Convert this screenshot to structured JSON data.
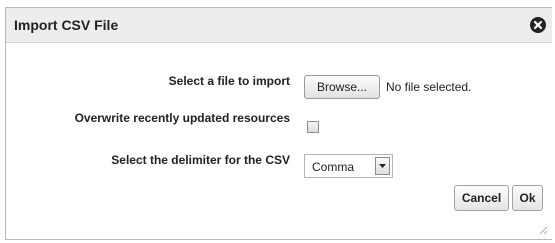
{
  "dialog": {
    "title": "Import CSV File",
    "close_icon": "close-circle-icon"
  },
  "form": {
    "file_label": "Select a file to import",
    "browse_label": "Browse...",
    "file_status": "No file selected.",
    "overwrite_label": "Overwrite recently updated resources",
    "overwrite_checked": false,
    "delimiter_label": "Select the delimiter for the CSV",
    "delimiter_value": "Comma"
  },
  "actions": {
    "cancel_label": "Cancel",
    "ok_label": "Ok"
  }
}
